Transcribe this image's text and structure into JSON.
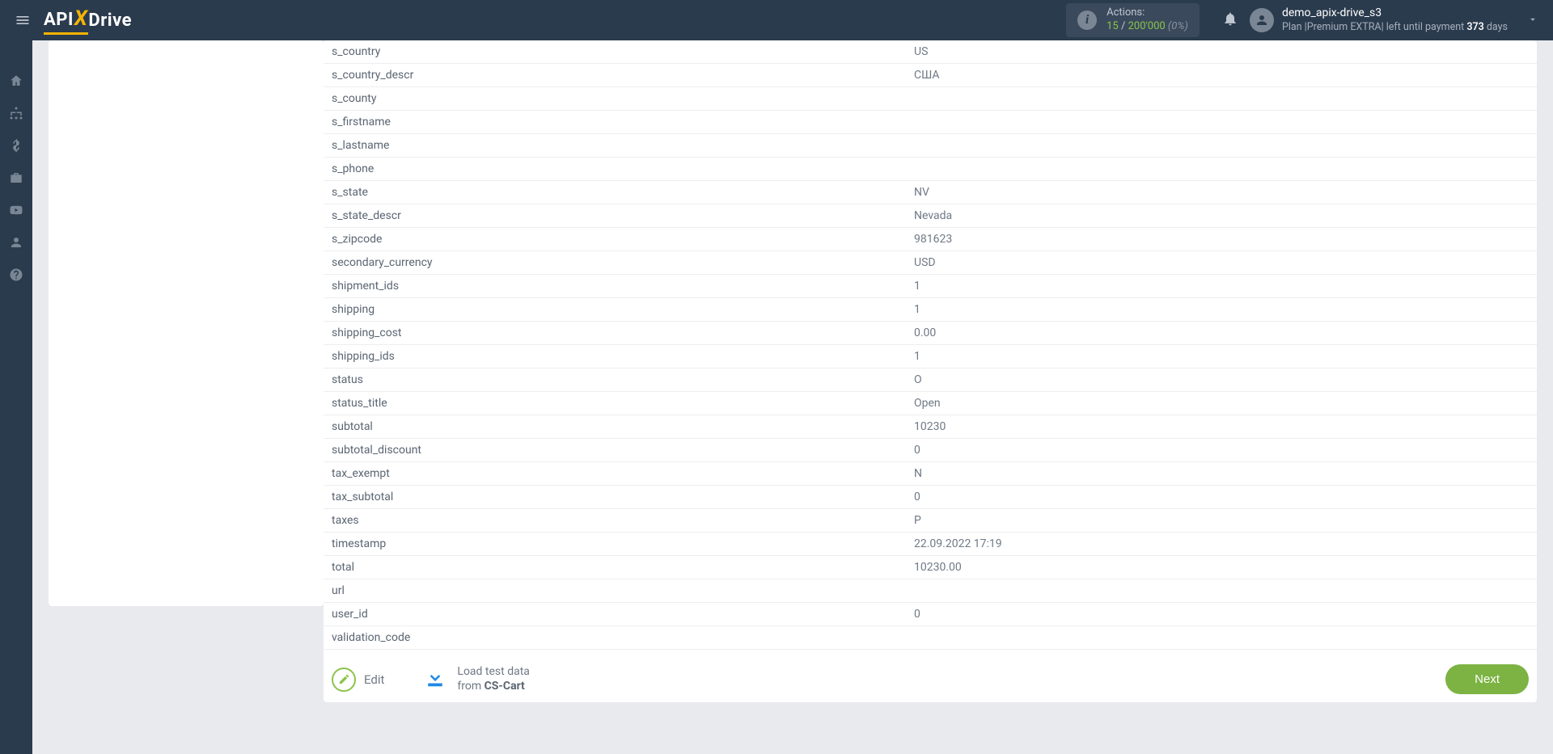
{
  "header": {
    "logo": {
      "api": "API",
      "x": "X",
      "drive": "Drive"
    },
    "actions": {
      "label": "Actions:",
      "used": "15",
      "sep": " / ",
      "limit": "200'000",
      "pct": "(0%)"
    },
    "user": {
      "name": "demo_apix-drive_s3",
      "plan_prefix": "Plan |Premium EXTRA| left until payment ",
      "plan_days": "373",
      "plan_suffix": " days"
    }
  },
  "table": {
    "rows": [
      {
        "k": "s_country",
        "v": "US"
      },
      {
        "k": "s_country_descr",
        "v": "США"
      },
      {
        "k": "s_county",
        "v": ""
      },
      {
        "k": "s_firstname",
        "v": ""
      },
      {
        "k": "s_lastname",
        "v": ""
      },
      {
        "k": "s_phone",
        "v": ""
      },
      {
        "k": "s_state",
        "v": "NV"
      },
      {
        "k": "s_state_descr",
        "v": "Nevada"
      },
      {
        "k": "s_zipcode",
        "v": "981623"
      },
      {
        "k": "secondary_currency",
        "v": "USD"
      },
      {
        "k": "shipment_ids",
        "v": "1"
      },
      {
        "k": "shipping",
        "v": "1"
      },
      {
        "k": "shipping_cost",
        "v": "0.00"
      },
      {
        "k": "shipping_ids",
        "v": "1"
      },
      {
        "k": "status",
        "v": "O"
      },
      {
        "k": "status_title",
        "v": "Open"
      },
      {
        "k": "subtotal",
        "v": "10230"
      },
      {
        "k": "subtotal_discount",
        "v": "0"
      },
      {
        "k": "tax_exempt",
        "v": "N"
      },
      {
        "k": "tax_subtotal",
        "v": "0"
      },
      {
        "k": "taxes",
        "v": "P"
      },
      {
        "k": "timestamp",
        "v": "22.09.2022 17:19"
      },
      {
        "k": "total",
        "v": "10230.00"
      },
      {
        "k": "url",
        "v": ""
      },
      {
        "k": "user_id",
        "v": "0"
      },
      {
        "k": "validation_code",
        "v": ""
      }
    ]
  },
  "footer": {
    "edit": "Edit",
    "load_line1": "Load test data",
    "load_line2_prefix": "from ",
    "load_line2_strong": "CS-Cart",
    "next": "Next"
  }
}
